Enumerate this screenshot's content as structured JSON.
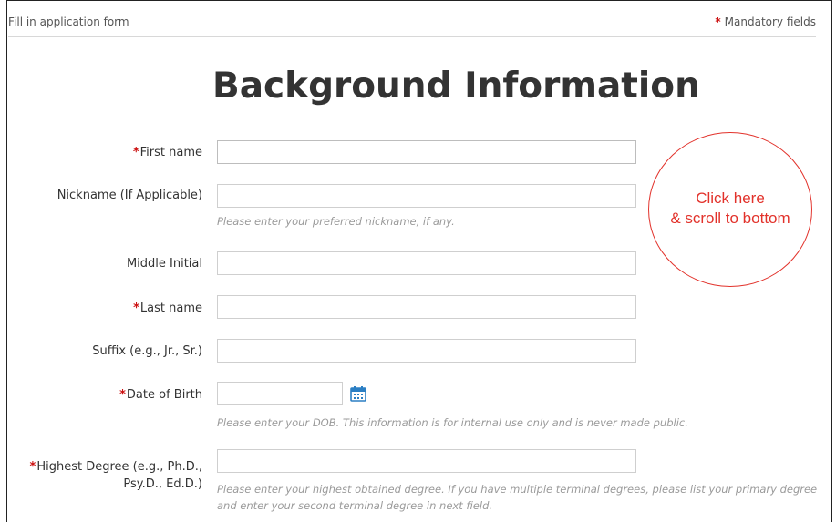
{
  "header": {
    "left_text": "Fill in application form",
    "required_mark": "*",
    "right_text": "Mandatory fields"
  },
  "page_title": "Background Information",
  "fields": [
    {
      "label": "First name",
      "required": true,
      "value": "",
      "hint": ""
    },
    {
      "label": "Nickname (If Applicable)",
      "required": false,
      "value": "",
      "hint": "Please enter your preferred nickname, if any."
    },
    {
      "label": "Middle Initial",
      "required": false,
      "value": "",
      "hint": ""
    },
    {
      "label": "Last name",
      "required": true,
      "value": "",
      "hint": ""
    },
    {
      "label": "Suffix (e.g., Jr., Sr.)",
      "required": false,
      "value": "",
      "hint": ""
    },
    {
      "label": "Date of Birth",
      "required": true,
      "value": "",
      "hint": "Please enter your DOB. This information is for internal use only and is never made public."
    },
    {
      "label_line1": "Highest Degree (e.g., Ph.D.,",
      "label_line2": "Psy.D., Ed.D.)",
      "required": true,
      "value": "",
      "hint": "Please enter your highest obtained degree. If you have multiple terminal degrees, please list your primary degree and enter your second terminal degree in next field."
    }
  ],
  "annotation": {
    "line1": "Click here",
    "line2": "& scroll to bottom",
    "color": "#e2322b"
  },
  "icons": {
    "date_picker": "calendar-icon"
  },
  "colors": {
    "required": "#cc1111",
    "hint": "#9a9a9a",
    "calendar": "#2b7fc4"
  }
}
